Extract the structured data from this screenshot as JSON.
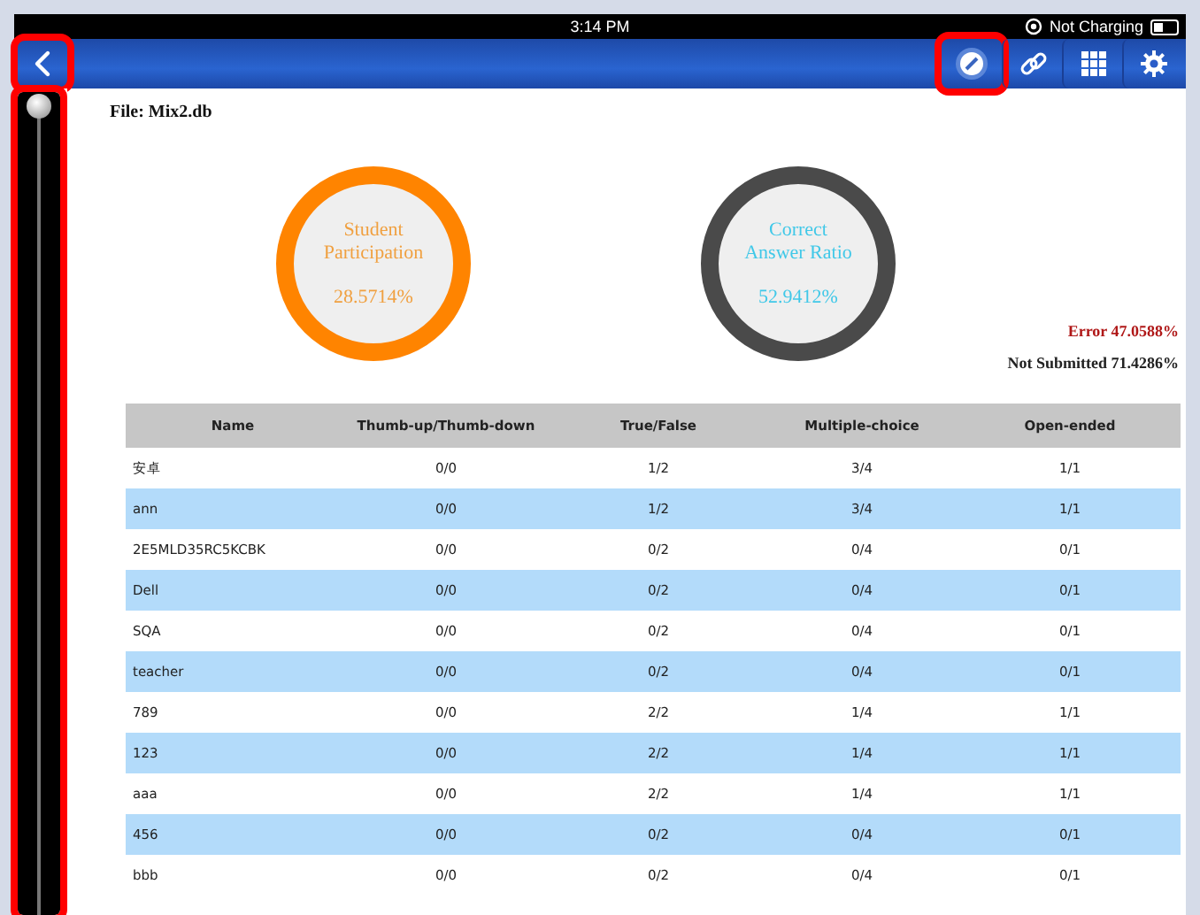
{
  "status_bar": {
    "time": "3:14 PM",
    "charging_status": "Not Charging"
  },
  "nav_bar": {
    "back_button": {
      "highlighted": true
    },
    "tools": [
      {
        "kind": "pen",
        "highlighted": true
      },
      {
        "kind": "link",
        "highlighted": false
      },
      {
        "kind": "grid",
        "highlighted": false
      },
      {
        "kind": "settings",
        "highlighted": false
      }
    ]
  },
  "side_slider": {
    "level": 0,
    "highlighted": true
  },
  "file_label": "File: Mix2.db",
  "stats": [
    {
      "title": {
        "text": "Student Participation",
        "color": "#f0a040"
      },
      "value": "28.5714%",
      "color": "#ff8400"
    },
    {
      "title": {
        "text": "Correct Answer Ratio",
        "color": "#40c8e8"
      },
      "value": "52.9412%",
      "color": "#4a4a4a"
    }
  ],
  "summary": [
    {
      "kind": "error",
      "text": "Error 47.0588%"
    },
    {
      "kind": "not_submitted",
      "text": "Not Submitted 71.4286%"
    }
  ],
  "table": {
    "columns": [
      "Name",
      "Thumb-up/Thumb-down",
      "True/False",
      "Multiple-choice",
      "Open-ended"
    ],
    "rows": [
      [
        "安卓",
        "0/0",
        "1/2",
        "3/4",
        "1/1"
      ],
      [
        "ann",
        "0/0",
        "1/2",
        "3/4",
        "1/1"
      ],
      [
        "2E5MLD35RC5KCBK",
        "0/0",
        "0/2",
        "0/4",
        "0/1"
      ],
      [
        "Dell",
        "0/0",
        "0/2",
        "0/4",
        "0/1"
      ],
      [
        "SQA",
        "0/0",
        "0/2",
        "0/4",
        "0/1"
      ],
      [
        "teacher",
        "0/0",
        "0/2",
        "0/4",
        "0/1"
      ],
      [
        "789",
        "0/0",
        "2/2",
        "1/4",
        "1/1"
      ],
      [
        "123",
        "0/0",
        "2/2",
        "1/4",
        "1/1"
      ],
      [
        "aaa",
        "0/0",
        "2/2",
        "1/4",
        "1/1"
      ],
      [
        "456",
        "0/0",
        "0/2",
        "0/4",
        "0/1"
      ],
      [
        "bbb",
        "0/0",
        "0/2",
        "0/4",
        "0/1"
      ]
    ]
  }
}
